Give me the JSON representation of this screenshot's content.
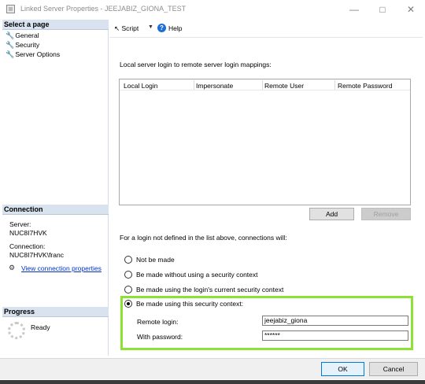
{
  "window": {
    "title": "Linked Server Properties - JEEJABIZ_GIONA_TEST",
    "minimize_icon": "minimize-icon",
    "maximize_icon": "maximize-icon",
    "close_icon": "close-icon"
  },
  "left": {
    "select_page_header": "Select a page",
    "pages": [
      {
        "label": "General",
        "icon": "wrench-icon"
      },
      {
        "label": "Security",
        "icon": "wrench-icon"
      },
      {
        "label": "Server Options",
        "icon": "wrench-icon"
      }
    ],
    "connection_header": "Connection",
    "server_label": "Server:",
    "server_value": "NUC8I7HVK",
    "connection_label": "Connection:",
    "connection_value": "NUC8I7HVK\\franc",
    "view_connection_properties": "View connection properties",
    "progress_header": "Progress",
    "progress_status": "Ready"
  },
  "toolbar": {
    "script_label": "Script",
    "help_label": "Help"
  },
  "main": {
    "mappings_label": "Local server login to remote server login mappings:",
    "grid_columns": [
      "Local Login",
      "Impersonate",
      "Remote User",
      "Remote Password"
    ],
    "add_button": "Add",
    "remove_button": "Remove",
    "not_defined_label": "For a login not defined in the list above, connections will:",
    "options": [
      {
        "label": "Not be made",
        "checked": false
      },
      {
        "label": "Be made without using a security context",
        "checked": false
      },
      {
        "label": "Be made using the login's current security context",
        "checked": false
      },
      {
        "label": "Be made using this security context:",
        "checked": true
      }
    ],
    "remote_login_label": "Remote login:",
    "remote_login_value": "jeejabiz_giona",
    "password_label": "With password:",
    "password_value": "******"
  },
  "buttons": {
    "ok": "OK",
    "cancel": "Cancel"
  },
  "colors": {
    "highlight": "#8ce234",
    "section_header": "#d9e2ef",
    "link": "#0033cc",
    "ok_border": "#0078d7"
  }
}
